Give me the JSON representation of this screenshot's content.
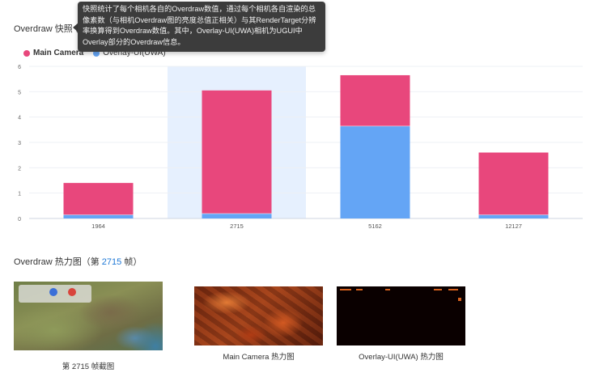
{
  "snapshot": {
    "title": "Overdraw 快照",
    "info_icon": "i",
    "tooltip": "快照统计了每个相机各自的Overdraw数值，通过每个相机各自渲染的总像素数（与相机Overdraw图的亮度总值正相关）与其RenderTarget分辨率换算得到Overdraw数值。其中，Overlay-UI(UWA)相机为UGUI中Overlay部分的Overdraw信息。"
  },
  "colors": {
    "main_camera": "#e8477c",
    "overlay": "#64a5f5",
    "highlight_band": "#e6f0fe"
  },
  "chart_data": {
    "type": "bar",
    "stacked": true,
    "categories": [
      "1964",
      "2715",
      "5162",
      "12127"
    ],
    "highlight_category": "2715",
    "series": [
      {
        "name": "Overlay-UI(UWA)",
        "values": [
          0.15,
          0.2,
          3.65,
          0.15
        ]
      },
      {
        "name": "Main Camera",
        "values": [
          1.25,
          4.85,
          2.0,
          2.45
        ]
      }
    ],
    "ylim": [
      0,
      6
    ],
    "yticks": [
      "0",
      "1",
      "2",
      "3",
      "4",
      "5",
      "6"
    ],
    "grid": true,
    "legend": "top-left"
  },
  "heatmap": {
    "title_prefix": "Overdraw 热力图（第 ",
    "frame": "2715",
    "title_suffix": " 帧）",
    "captions": {
      "frame": "第 2715 帧截图",
      "main": "Main Camera 热力图",
      "overlay": "Overlay-UI(UWA) 热力图"
    }
  }
}
